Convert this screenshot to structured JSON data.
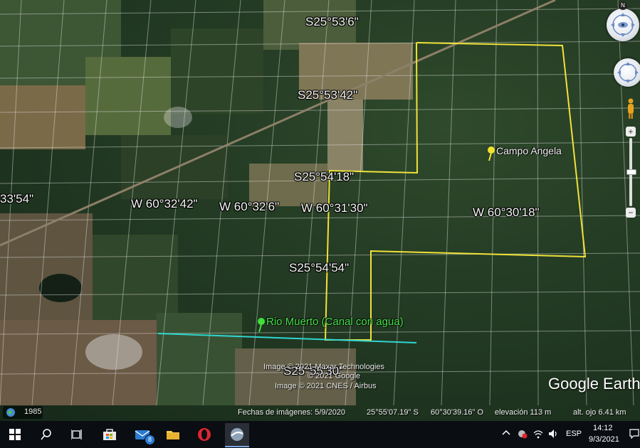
{
  "map": {
    "coordinates": {
      "lat_1": "S25°53'6\"",
      "lat_2": "S25°53'42\"",
      "lat_3": "S25°54'18\"",
      "lat_4": "S25°54'54\"",
      "lat_5": "S25°55'30\"",
      "lon_left": "33'54\"",
      "lon_1": "W 60°32'42\"",
      "lon_2": "W 60°32'6\"",
      "lon_3": "W 60°31'30\"",
      "lon_4": "W 60°30'18\""
    },
    "placemarks": [
      {
        "label": "Campo Angela",
        "color": "#f3e22c"
      },
      {
        "label": "Rio Muerto (Canal con agua)",
        "color": "#3ee03a"
      }
    ],
    "boundary_color": "#f1e23a",
    "canal_color": "#2fd6d0",
    "credits": [
      "Image © 2021 Maxar Technologies",
      "© 2021 Google",
      "Image © 2021 CNES / Airbus"
    ],
    "logo": "Google Earth"
  },
  "status_bar": {
    "year": "1985",
    "image_date": "Fechas de imágenes: 5/9/2020",
    "lat": "25°55'07.19\" S",
    "lon": "60°30'39.16\" O",
    "elevation": "elevación  113 m",
    "eye_alt": "alt. ojo  6.41 km"
  },
  "taskbar": {
    "mail_badge": "8",
    "language": "ESP",
    "time": "14:12",
    "date": "9/3/2021"
  },
  "nav": {
    "north_label": "N",
    "zoom_in": "+",
    "zoom_out": "−"
  }
}
